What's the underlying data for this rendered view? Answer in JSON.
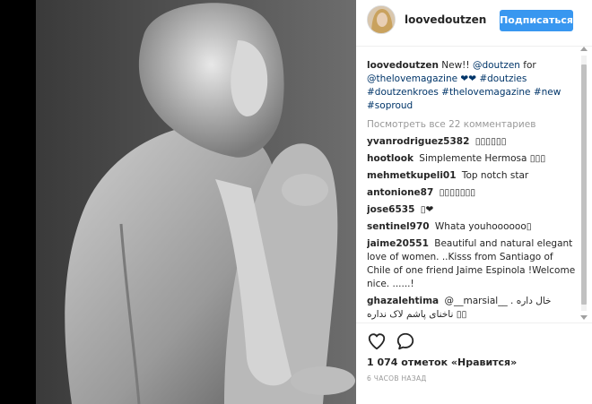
{
  "post": {
    "username": "loovedoutzen",
    "follow_label": "Подписаться",
    "caption": {
      "username": "loovedoutzen",
      "text_before": "New!! ",
      "mention": "@doutzen",
      "text_middle": " for ",
      "tags_line": "@thelovemagazine ❤❤ #doutzies #doutzenkroes #thelovemagazine #new #soproud"
    },
    "view_all_comments": "Посмотреть все 22 комментариев",
    "comments": [
      {
        "user": "yvanrodriguez5382",
        "text": "▯▯▯▯▯▯"
      },
      {
        "user": "hootlook",
        "text": "Simplemente Hermosa ▯▯▯"
      },
      {
        "user": "mehmetkupeli01",
        "text": "Top notch star"
      },
      {
        "user": "antonione87",
        "text": "▯▯▯▯▯▯▯"
      },
      {
        "user": "jose6535",
        "text": "▯❤"
      },
      {
        "user": "sentinel970",
        "text": "Whata youhoooooo▯"
      },
      {
        "user": "jaime20551",
        "text": "Beautiful and natural elegant love of women. ..Kisss from Santiago of Chile of one friend Jaime Espinola !Welcome nice. ......!"
      },
      {
        "user": "ghazalehtima",
        "text": "@__marsial__ خال داره . ناخنای پاشم لاک نداره ▯▯"
      }
    ],
    "likes": "1 074 отметок «Нравится»",
    "time_ago": "6 ЧАСОВ НАЗАД"
  },
  "colors": {
    "accent": "#3897f0",
    "link": "#003569",
    "muted": "#999999"
  },
  "icons": {
    "like": "heart-outline-icon",
    "comment": "speech-bubble-icon"
  }
}
